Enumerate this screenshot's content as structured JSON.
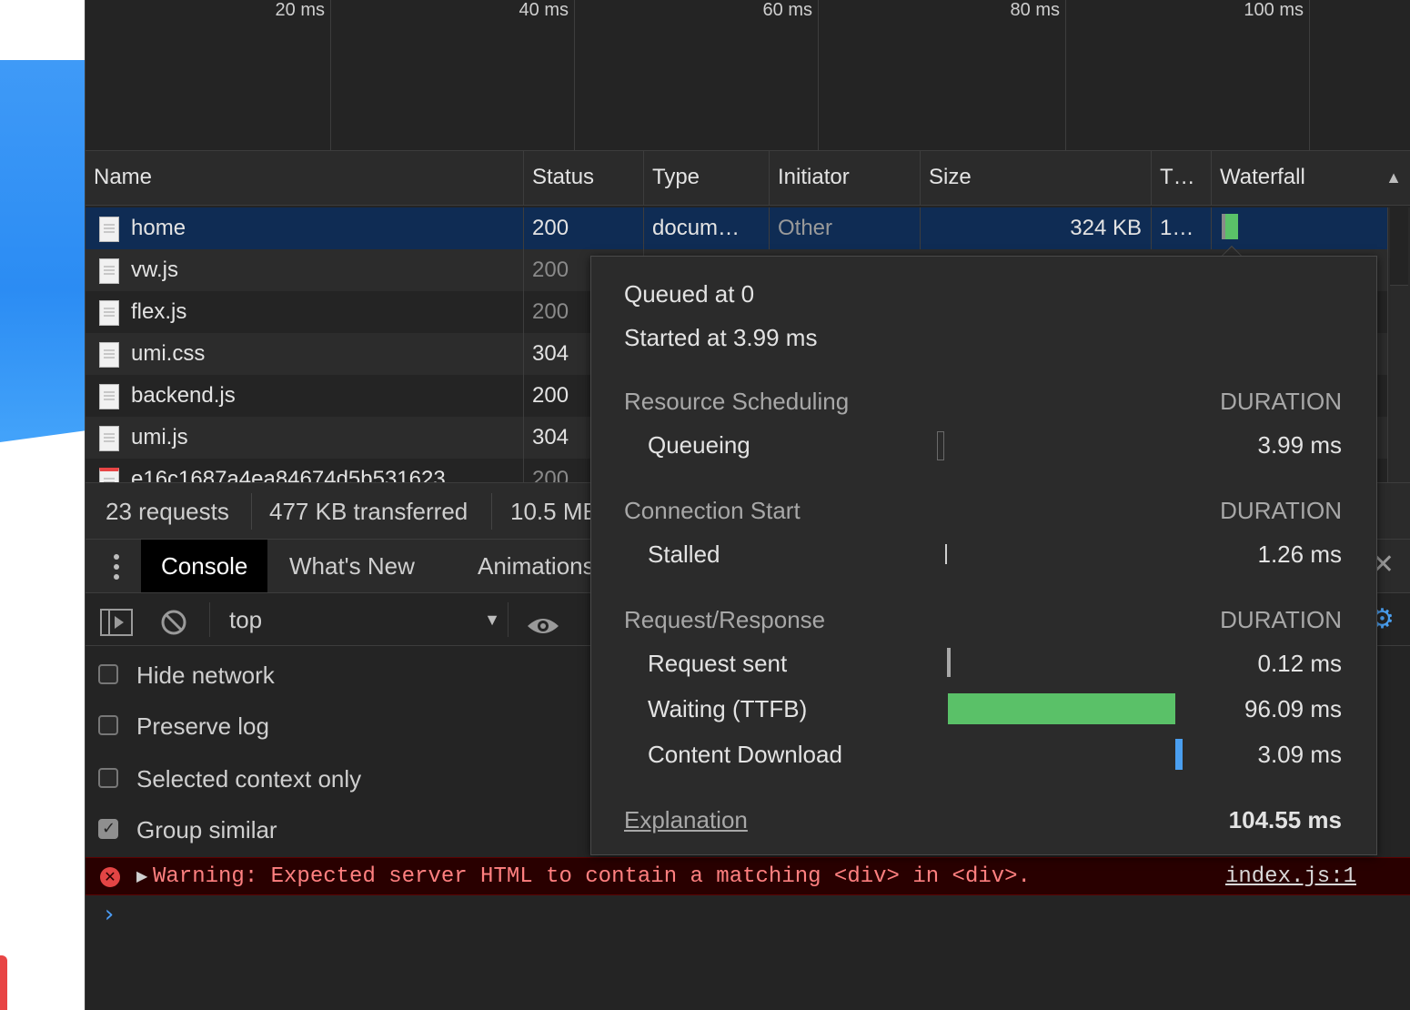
{
  "timeline": {
    "ticks": [
      "20 ms",
      "40 ms",
      "60 ms",
      "80 ms",
      "100 ms"
    ]
  },
  "columns": {
    "name": "Name",
    "status": "Status",
    "type": "Type",
    "initiator": "Initiator",
    "size": "Size",
    "time": "T…",
    "waterfall": "Waterfall",
    "sort_icon": "sort-ascending-icon"
  },
  "requests": [
    {
      "name": "home",
      "status": "200",
      "type": "docum…",
      "initiator": "Other",
      "size": "324 KB",
      "time": "1…"
    },
    {
      "name": "vw.js",
      "status": "200"
    },
    {
      "name": "flex.js",
      "status": "200"
    },
    {
      "name": "umi.css",
      "status": "304"
    },
    {
      "name": "backend.js",
      "status": "200"
    },
    {
      "name": "umi.js",
      "status": "304"
    },
    {
      "name": "e16c1687a4ea84674d5b531623",
      "status": "200"
    }
  ],
  "summary": {
    "requests": "23 requests",
    "transferred": "477 KB transferred",
    "resources": "10.5 ME"
  },
  "drawer": {
    "tabs": [
      "Console",
      "What's New",
      "Animations"
    ],
    "active_tab": "Console"
  },
  "console_toolbar": {
    "context": "top"
  },
  "settings": [
    {
      "label": "Hide network",
      "checked": false
    },
    {
      "label": "Preserve log",
      "checked": false
    },
    {
      "label": "Selected context only",
      "checked": false
    },
    {
      "label": "Group similar",
      "checked": true
    }
  ],
  "warning": {
    "message": "Warning: Expected server HTML to contain a matching <div> in <div>.",
    "source": "index.js:1"
  },
  "prompt_symbol": "›",
  "timing": {
    "queued_at": "Queued at 0",
    "started_at": "Started at 3.99 ms",
    "sections": [
      {
        "title": "Resource Scheduling",
        "duration_label": "DURATION",
        "items": [
          {
            "label": "Queueing",
            "value": "3.99 ms"
          }
        ]
      },
      {
        "title": "Connection Start",
        "duration_label": "DURATION",
        "items": [
          {
            "label": "Stalled",
            "value": "1.26 ms"
          }
        ]
      },
      {
        "title": "Request/Response",
        "duration_label": "DURATION",
        "items": [
          {
            "label": "Request sent",
            "value": "0.12 ms"
          },
          {
            "label": "Waiting (TTFB)",
            "value": "96.09 ms"
          },
          {
            "label": "Content Download",
            "value": "3.09 ms"
          }
        ]
      }
    ],
    "explanation": "Explanation",
    "total": "104.55 ms"
  },
  "colors": {
    "selected_row": "#0f2c54",
    "ttfb_bar": "#5ac168",
    "download_bar": "#4a9ff0",
    "error_bg": "#290000",
    "error_text": "#ff8080"
  }
}
